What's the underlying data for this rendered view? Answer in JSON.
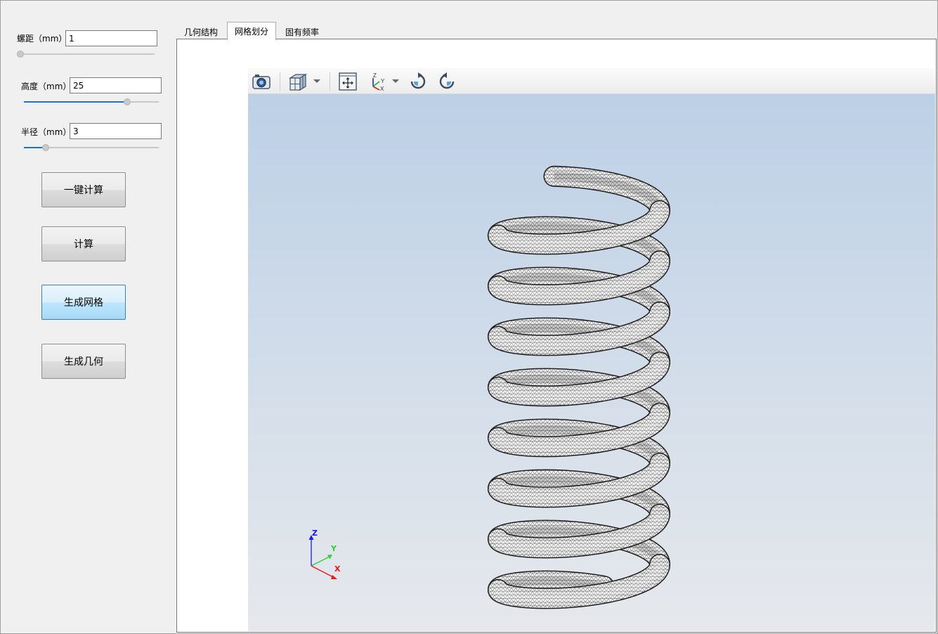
{
  "params": {
    "pitch": {
      "label": "螺距（mm）",
      "value": "1",
      "slider_fraction": 0.0
    },
    "height": {
      "label": "高度（mm）",
      "value": "25",
      "slider_fraction": 0.76
    },
    "radius": {
      "label": "半径（mm）",
      "value": "3",
      "slider_fraction": 0.16
    }
  },
  "buttons": {
    "one_click": "一键计算",
    "compute": "计算",
    "gen_mesh": "生成网格",
    "gen_geometry": "生成几何"
  },
  "tabs": [
    {
      "label": "几何结构"
    },
    {
      "label": "网格划分",
      "active": true
    },
    {
      "label": "固有频率"
    }
  ],
  "toolbar": {
    "icons": [
      "camera-icon",
      "view-cube-icon",
      "fit-all-icon",
      "axes-orientation-icon",
      "rotate-cw-icon",
      "rotate-ccw-icon"
    ]
  },
  "triad": {
    "x": "X",
    "y": "Y",
    "z": "Z"
  },
  "colors": {
    "accent": "#1976c9",
    "scene_top": "#bcd0e6",
    "scene_bottom": "#e6e8ec",
    "axis_x": "#e21b1b",
    "axis_y": "#2bd12b",
    "axis_z": "#1a1ae6"
  }
}
